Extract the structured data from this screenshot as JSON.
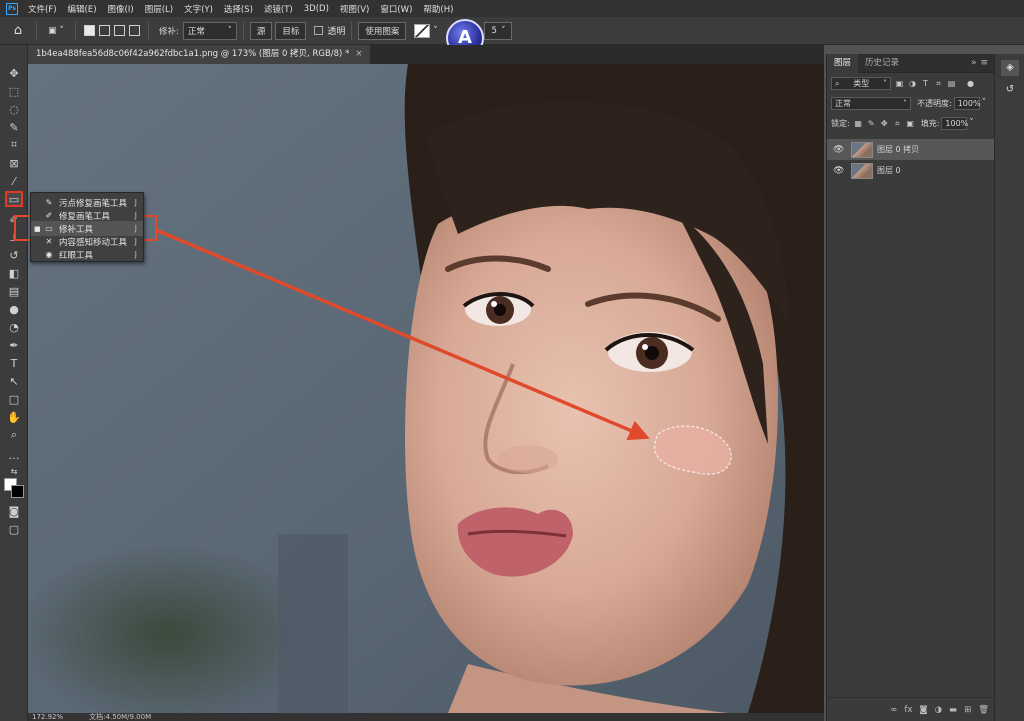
{
  "app": {
    "logo": "Ps"
  },
  "menu": [
    "文件(F)",
    "编辑(E)",
    "图像(I)",
    "图层(L)",
    "文字(Y)",
    "选择(S)",
    "滤镜(T)",
    "3D(D)",
    "视图(V)",
    "窗口(W)",
    "帮助(H)"
  ],
  "options_bar": {
    "patch_label": "修补:",
    "patch_mode": "正常",
    "source_btn": "源",
    "target_btn": "目标",
    "transparent_label": "透明",
    "use_pattern_btn": "使用图案",
    "diffusion_value": "5"
  },
  "document_tab": {
    "title": "1b4ea488fea56d8c06f42a962fdbc1a1.png @ 173% (图层 0 拷贝, RGB/8) *",
    "close": "×"
  },
  "flyout": {
    "items": [
      {
        "label": "污点修复画笔工具",
        "key": "J",
        "icon": "spot-healing-brush-icon"
      },
      {
        "label": "修复画笔工具",
        "key": "J",
        "icon": "healing-brush-icon"
      },
      {
        "label": "修补工具",
        "key": "J",
        "icon": "patch-icon",
        "selected": true
      },
      {
        "label": "内容感知移动工具",
        "key": "J",
        "icon": "content-aware-move-icon"
      },
      {
        "label": "红眼工具",
        "key": "J",
        "icon": "red-eye-icon"
      }
    ]
  },
  "layers_panel": {
    "tabs": [
      "图层",
      "历史记录"
    ],
    "filter_type": "类型",
    "blend_mode": "正常",
    "opacity_label": "不透明度:",
    "opacity_value": "100%",
    "lock_label": "锁定:",
    "fill_label": "填充:",
    "fill_value": "100%",
    "layers": [
      {
        "name": "图层 0 拷贝",
        "selected": true
      },
      {
        "name": "图层 0",
        "selected": false
      }
    ]
  },
  "status": {
    "zoom": "172.92%",
    "doc_size": "文档:4.50M/9.00M"
  },
  "colors": {
    "annotation": "#e04a2c",
    "ps_blue": "#31a8ff"
  }
}
